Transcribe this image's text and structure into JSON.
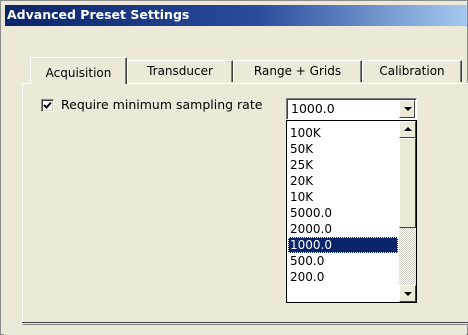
{
  "window": {
    "title": "Advanced Preset Settings"
  },
  "tabs": [
    {
      "label": "Acquisition",
      "active": true
    },
    {
      "label": "Transducer",
      "active": false
    },
    {
      "label": "Range + Grids",
      "active": false
    },
    {
      "label": "Calibration",
      "active": false
    }
  ],
  "acquisition": {
    "require_min_sampling": {
      "label": "Require minimum sampling rate",
      "checked": true
    },
    "sampling_rate": {
      "value": "1000.0",
      "options": [
        "100K",
        "50K",
        "25K",
        "20K",
        "10K",
        "5000.0",
        "2000.0",
        "1000.0",
        "500.0",
        "200.0"
      ],
      "highlighted": "1000.0"
    }
  },
  "colors": {
    "titlebar_start": "#0a246a",
    "titlebar_end": "#a6caf0",
    "selection": "#0a246a",
    "face": "#ece9d8"
  },
  "icons": {
    "check": "check-mark-icon",
    "combo_arrow": "chevron-down-icon",
    "scroll_up": "arrow-up-icon",
    "scroll_down": "arrow-down-icon"
  }
}
